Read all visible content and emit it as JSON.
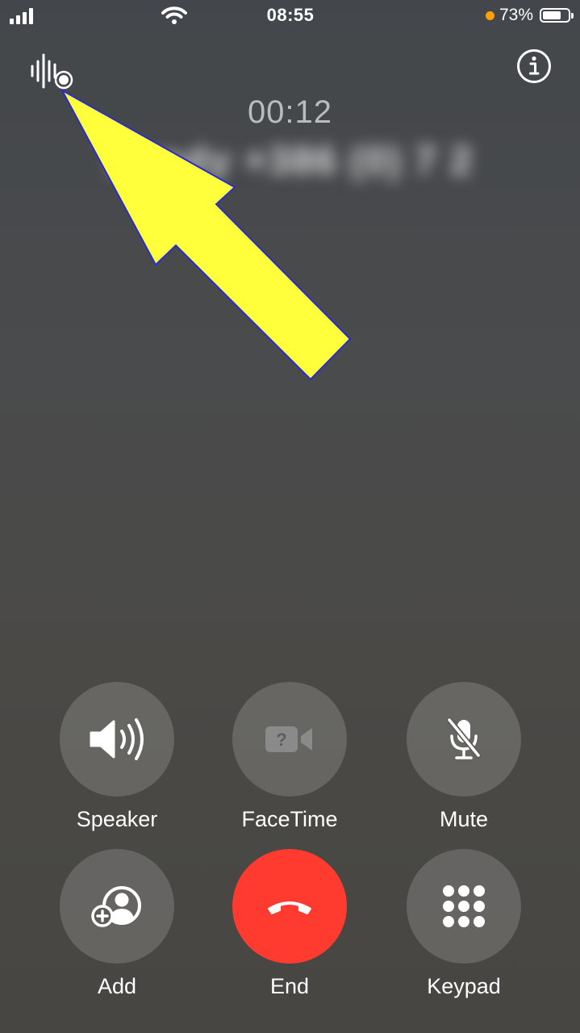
{
  "status_bar": {
    "time": "08:55",
    "battery_percent": "73%",
    "battery_level": 0.73,
    "privacy_indicator_color": "#ff9f0a"
  },
  "call": {
    "timer": "00:12",
    "caller": "Sandy +386 (0) 7 2"
  },
  "icons": {
    "top_left": "call-recording-waveform-icon",
    "top_right": "info-icon",
    "annotation": "yellow-arrow-pointing-to-recording-icon"
  },
  "controls": [
    {
      "label": "Speaker",
      "icon": "speaker-icon"
    },
    {
      "label": "FaceTime",
      "icon": "facetime-icon"
    },
    {
      "label": "Mute",
      "icon": "mute-icon"
    },
    {
      "label": "Add",
      "icon": "add-call-icon"
    },
    {
      "label": "End",
      "icon": "end-call-icon",
      "color": "#ff3b30"
    },
    {
      "label": "Keypad",
      "icon": "keypad-icon"
    }
  ]
}
